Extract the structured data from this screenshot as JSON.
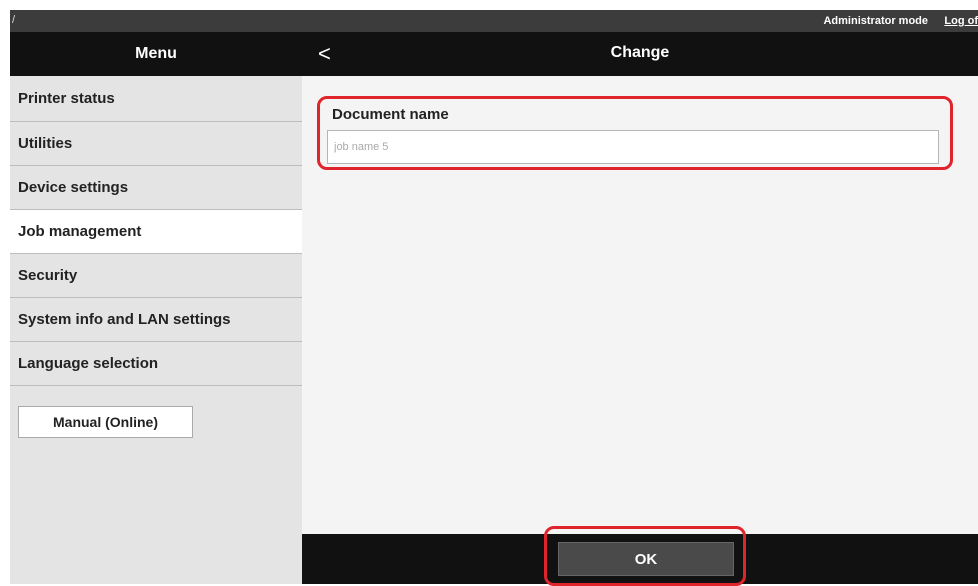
{
  "topbar": {
    "slash": "/",
    "mode": "Administrator mode",
    "logout": "Log of"
  },
  "menu": {
    "title": "Menu"
  },
  "header": {
    "back_icon": "<",
    "title": "Change"
  },
  "sidebar": {
    "items": [
      {
        "label": "Printer status"
      },
      {
        "label": "Utilities"
      },
      {
        "label": "Device settings"
      },
      {
        "label": "Job management",
        "active": true
      },
      {
        "label": "Security"
      },
      {
        "label": "System info and LAN settings"
      },
      {
        "label": "Language selection"
      }
    ],
    "manual_button": "Manual (Online)"
  },
  "form": {
    "document_name_label": "Document name",
    "document_name_value": "job name 5"
  },
  "footer": {
    "ok_label": "OK"
  },
  "colors": {
    "header_bg": "#111111",
    "highlight": "#e0242b",
    "sidebar_bg": "#e4e4e4"
  }
}
